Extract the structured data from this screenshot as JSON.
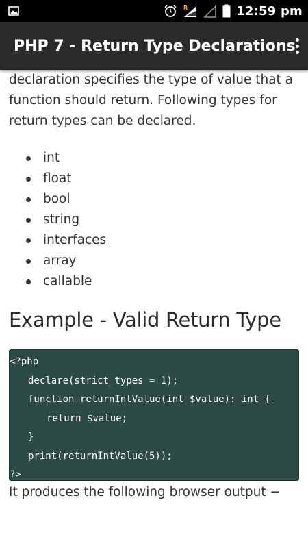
{
  "status_bar": {
    "time": "12:59 pm",
    "icons": [
      "gallery-notification-icon",
      "alarm-icon",
      "roaming-signal-icon",
      "signal-icon",
      "battery-icon"
    ],
    "roaming_label": "R"
  },
  "app_bar": {
    "title": "PHP 7 - Return Type Declarations",
    "menu_icon": "overflow-menu-icon"
  },
  "content": {
    "intro_lines": [
      "declaration specifies the type of value that a",
      "function should return. Following types for",
      "return types can be declared."
    ],
    "types": [
      "int",
      "float",
      "bool",
      "string",
      "interfaces",
      "array",
      "callable"
    ],
    "example_heading": "Example - Valid Return Type",
    "code_lines": [
      "<?php",
      "declare(strict_types = 1);",
      "function returnIntValue(int $value): int {",
      "return $value;",
      "}",
      "print(returnIntValue(5));",
      "?>"
    ],
    "output_text": "It produces the following browser output −"
  },
  "colors": {
    "status_bar": "#000000",
    "app_bar": "#2b2b2b",
    "code_bg": "#2c4a46",
    "text": "#333333"
  }
}
